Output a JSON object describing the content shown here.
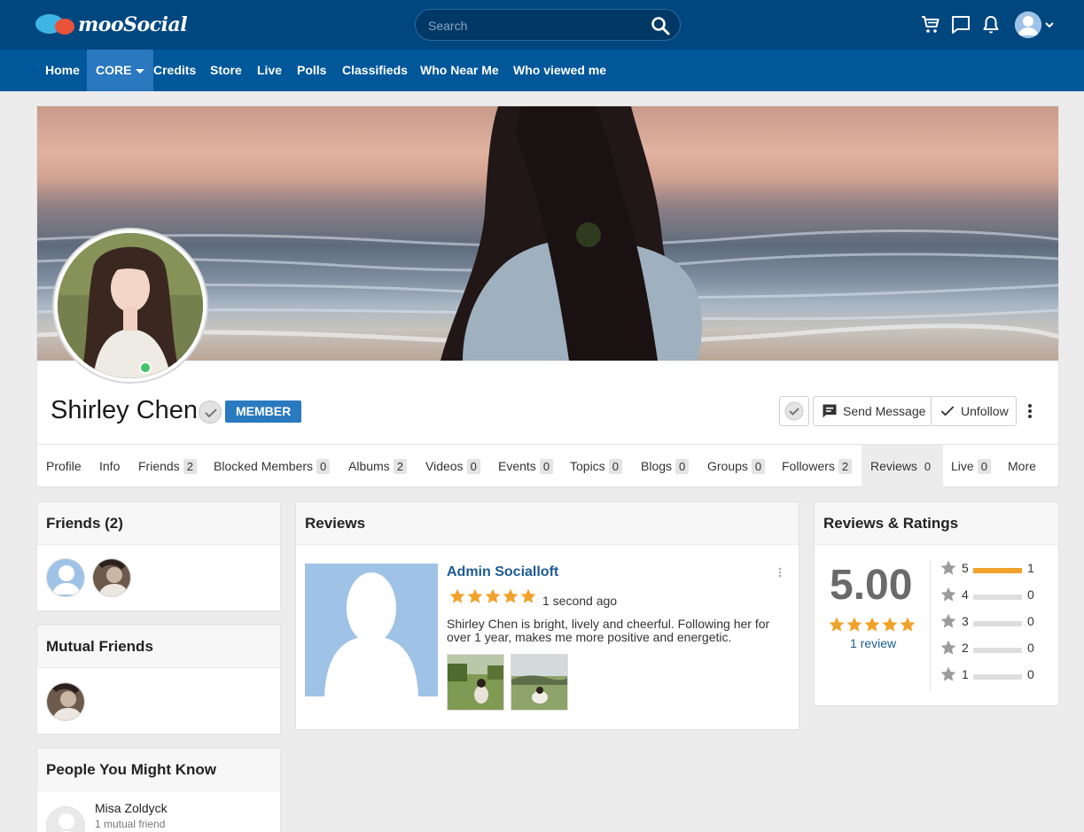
{
  "app": {
    "logo_text": "mooSocial"
  },
  "search": {
    "placeholder": "Search"
  },
  "nav": {
    "items": [
      {
        "label": "Home"
      },
      {
        "label": "CORE"
      },
      {
        "label": "Credits"
      },
      {
        "label": "Store"
      },
      {
        "label": "Live"
      },
      {
        "label": "Polls"
      },
      {
        "label": "Classifieds"
      },
      {
        "label": "Who Near Me"
      },
      {
        "label": "Who viewed me"
      }
    ]
  },
  "profile": {
    "name": "Shirley Chen",
    "badge": "MEMBER",
    "online": true,
    "buttons": {
      "send_message": "Send Message",
      "unfollow": "Unfollow"
    }
  },
  "tabs": [
    {
      "label": "Profile"
    },
    {
      "label": "Info"
    },
    {
      "label": "Friends",
      "count": "2"
    },
    {
      "label": "Blocked Members",
      "count": "0"
    },
    {
      "label": "Albums",
      "count": "2"
    },
    {
      "label": "Videos",
      "count": "0"
    },
    {
      "label": "Events",
      "count": "0"
    },
    {
      "label": "Topics",
      "count": "0"
    },
    {
      "label": "Blogs",
      "count": "0"
    },
    {
      "label": "Groups",
      "count": "0"
    },
    {
      "label": "Followers",
      "count": "2"
    },
    {
      "label": "Reviews",
      "count": "0"
    },
    {
      "label": "Live",
      "count": "0"
    },
    {
      "label": "More"
    }
  ],
  "friends_panel": {
    "title": "Friends (2)"
  },
  "mutual_panel": {
    "title": "Mutual Friends"
  },
  "people_panel": {
    "title": "People You Might Know",
    "people": [
      {
        "name": "Misa Zoldyck",
        "sub": "1 mutual friend"
      }
    ]
  },
  "reviews_panel": {
    "title": "Reviews",
    "review": {
      "author": "Admin Socialloft",
      "rating": 5,
      "time": "1 second ago",
      "text": "Shirley Chen is bright, lively and cheerful. Following her for over 1 year, makes me more positive and energetic."
    }
  },
  "ratings_panel": {
    "title": "Reviews & Ratings",
    "average": "5.00",
    "review_count": "1 review",
    "rows": [
      {
        "star": "5",
        "count": "1",
        "fraction": 1
      },
      {
        "star": "4",
        "count": "0",
        "fraction": 0
      },
      {
        "star": "3",
        "count": "0",
        "fraction": 0
      },
      {
        "star": "2",
        "count": "0",
        "fraction": 0
      },
      {
        "star": "1",
        "count": "0",
        "fraction": 0
      }
    ]
  },
  "colors": {
    "topbar": "#004780",
    "navbar": "#00579a",
    "nav_active": "#2a78bf",
    "accent": "#2a7abf",
    "star": "#f1a22a",
    "link": "#1c5a92",
    "online": "#43c46a"
  }
}
